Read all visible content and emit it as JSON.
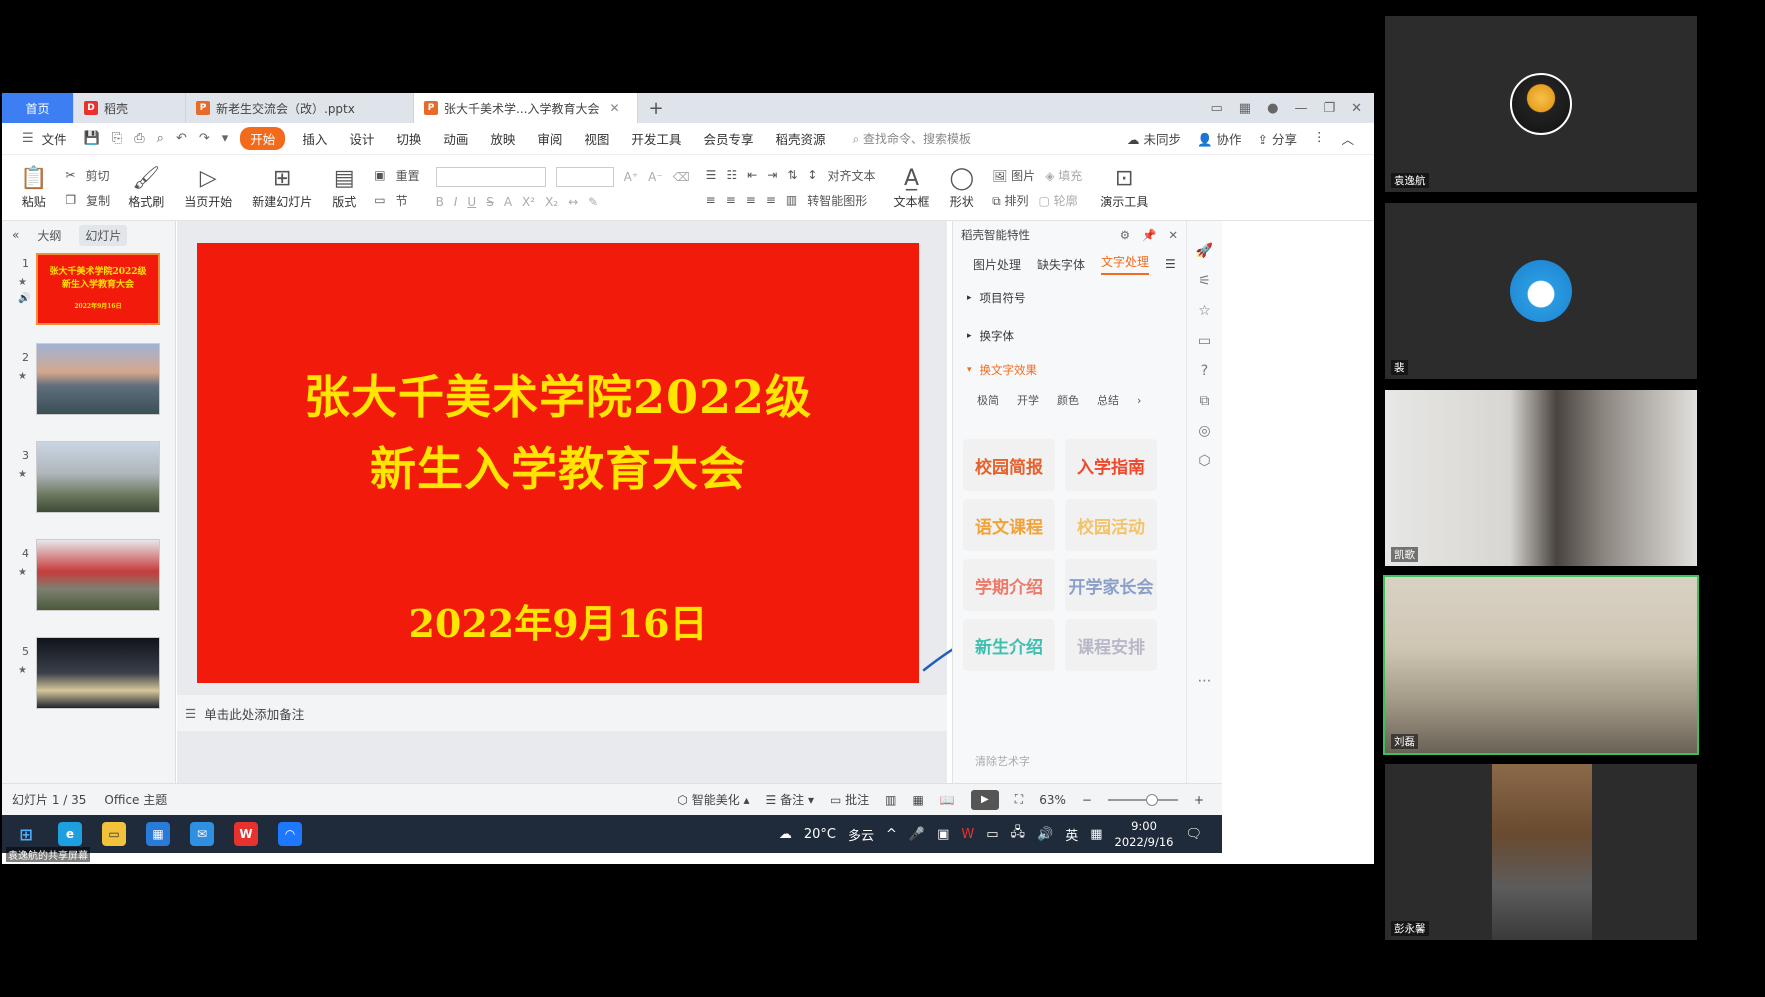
{
  "tabs": [
    {
      "label": "首页",
      "kind": "home"
    },
    {
      "label": "稻壳",
      "kind": "docer"
    },
    {
      "label": "新老生交流会（改）.pptx",
      "kind": "ppt"
    },
    {
      "label": "张大千美术学...入学教育大会",
      "kind": "ppt-active"
    }
  ],
  "menu": {
    "file": "文件",
    "items": [
      "开始",
      "插入",
      "设计",
      "切换",
      "动画",
      "放映",
      "审阅",
      "视图",
      "开发工具",
      "会员专享",
      "稻壳资源"
    ],
    "search_placeholder": "查找命令、搜索模板",
    "right": [
      "未同步",
      "协作",
      "分享"
    ]
  },
  "ribbon": {
    "paste": "粘贴",
    "cut": "剪切",
    "copy": "复制",
    "format_painter": "格式刷",
    "from_current": "当页开始",
    "new_slide": "新建幻灯片",
    "layout": "版式",
    "section": "节",
    "reset": "重置",
    "align_text": "对齐文本",
    "smart_graphic": "转智能图形",
    "text_box": "文本框",
    "shape": "形状",
    "arrange": "排列",
    "picture": "图片",
    "fill": "填充",
    "outline": "轮廓",
    "presentation_tools": "演示工具"
  },
  "left_panel": {
    "tab_outline": "大纲",
    "tab_slides": "幻灯片",
    "slides": [
      {
        "num": "1",
        "title_l1": "张大千美术学院2022级",
        "title_l2": "新生入学教育大会",
        "date": "2022年9月16日"
      },
      {
        "num": "2"
      },
      {
        "num": "3"
      },
      {
        "num": "4"
      },
      {
        "num": "5"
      }
    ]
  },
  "slide": {
    "line1": "张大千美术学院2022级",
    "line2": "新生入学教育大会",
    "date": "2022年9月16日"
  },
  "notes_placeholder": "单击此处添加备注",
  "right_panel": {
    "title": "稻壳智能特性",
    "tabs": [
      "图片处理",
      "缺失字体",
      "文字处理"
    ],
    "items": [
      "项目符号",
      "换字体",
      "换文字效果"
    ],
    "subtabs": [
      "极简",
      "开学",
      "颜色",
      "总结"
    ],
    "effects": [
      "校园简报",
      "入学指南",
      "语文课程",
      "校园活动",
      "学期介绍",
      "开学家长会",
      "新生介绍",
      "课程安排"
    ],
    "footer": "清除艺术字"
  },
  "status": {
    "slide_counter": "幻灯片 1 / 35",
    "theme": "Office 主题",
    "smart_beautify": "智能美化",
    "notes": "备注",
    "comments": "批注",
    "zoom": "63%",
    "zoom_value": 0.63
  },
  "taskbar": {
    "weather_temp": "20°C",
    "weather_desc": "多云",
    "ime": "英",
    "time": "9:00",
    "date": "2022/9/16",
    "share_label": "袁逸航的共享屏幕"
  },
  "participants": [
    {
      "name": "袁逸航",
      "avatar": "bw-avatar"
    },
    {
      "name": "裴",
      "avatar": "doraemon-avatar"
    },
    {
      "name": "凯歌",
      "video": true
    },
    {
      "name": "刘磊",
      "video": true,
      "speaking": true
    },
    {
      "name": "彭永馨",
      "video": true
    }
  ],
  "colors": {
    "slide_bg": "#f21a0a",
    "slide_text": "#ffe500",
    "accent": "#f26b1d",
    "home_tab": "#3d7ff3",
    "speaking": "#3ec05a"
  }
}
